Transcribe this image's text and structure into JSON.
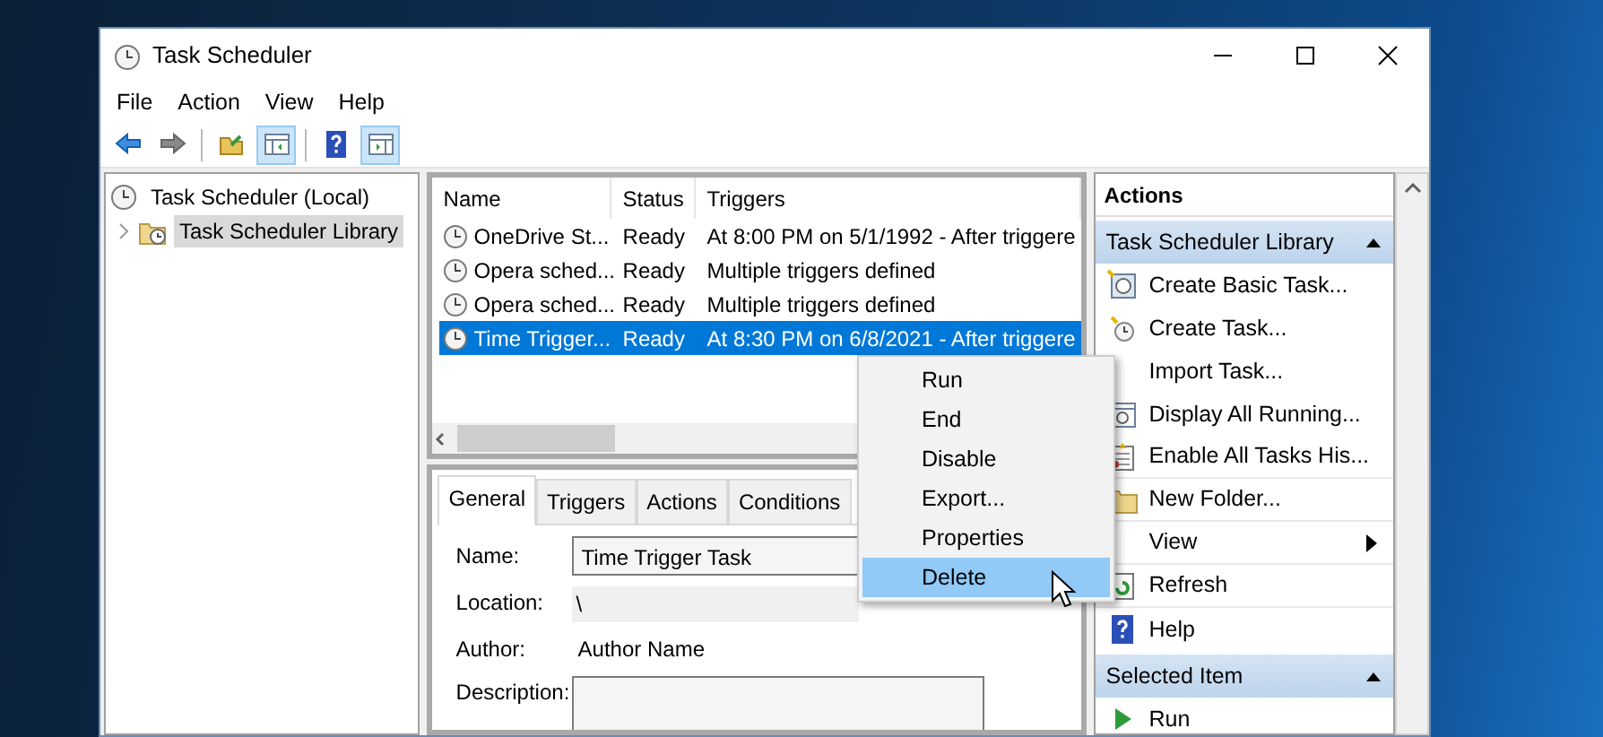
{
  "window": {
    "title": "Task Scheduler"
  },
  "menu": [
    "File",
    "Action",
    "View",
    "Help"
  ],
  "tree": [
    {
      "label": "Task Scheduler (Local)",
      "selected": false,
      "children": [
        {
          "label": "Task Scheduler Library",
          "selected": true,
          "expanded": false
        }
      ]
    }
  ],
  "task_list": {
    "columns": [
      "Name",
      "Status",
      "Triggers"
    ],
    "rows": [
      {
        "cells": [
          "OneDrive St...",
          "Ready",
          "At 8:00 PM on 5/1/1992 - After triggere"
        ],
        "selected": false
      },
      {
        "cells": [
          "Opera sched...",
          "Ready",
          "Multiple triggers defined"
        ],
        "selected": false
      },
      {
        "cells": [
          "Opera sched...",
          "Ready",
          "Multiple triggers defined"
        ],
        "selected": false
      },
      {
        "cells": [
          "Time Trigger...",
          "Ready",
          "At 8:30 PM on 6/8/2021 - After triggere"
        ],
        "selected": true
      }
    ]
  },
  "details": {
    "tabs": [
      {
        "label": "General",
        "selected": true
      },
      {
        "label": "Triggers",
        "selected": false
      },
      {
        "label": "Actions",
        "selected": false
      },
      {
        "label": "Conditions",
        "selected": false
      }
    ],
    "fields": [
      {
        "label": "Name:",
        "value": "Time Trigger Task",
        "kind": "input"
      },
      {
        "label": "Location:",
        "value": "\\",
        "kind": "readonly"
      },
      {
        "label": "Author:",
        "value": "Author Name",
        "kind": "text"
      },
      {
        "label": "Description:",
        "kind": "textarea"
      }
    ]
  },
  "context_menu": [
    {
      "label": "Run",
      "selected": false
    },
    {
      "label": "End",
      "selected": false
    },
    {
      "label": "Disable",
      "selected": false
    },
    {
      "label": "Export...",
      "selected": false
    },
    {
      "label": "Properties",
      "selected": false
    },
    {
      "label": "Delete",
      "selected": true
    }
  ],
  "actions": {
    "title": "Actions",
    "sections": [
      {
        "title": "Task Scheduler Library",
        "items": [
          {
            "label": "Create Basic Task..."
          },
          {
            "label": "Create Task..."
          },
          {
            "label": "Import Task..."
          },
          {
            "label": "Display All Running..."
          },
          {
            "label": "Enable All Tasks His..."
          },
          {
            "label": "New Folder..."
          },
          {
            "label": "View",
            "submenu": true
          },
          {
            "label": "Refresh"
          },
          {
            "label": "Help"
          }
        ]
      },
      {
        "title": "Selected Item",
        "items": [
          {
            "label": "Run"
          }
        ]
      }
    ]
  }
}
